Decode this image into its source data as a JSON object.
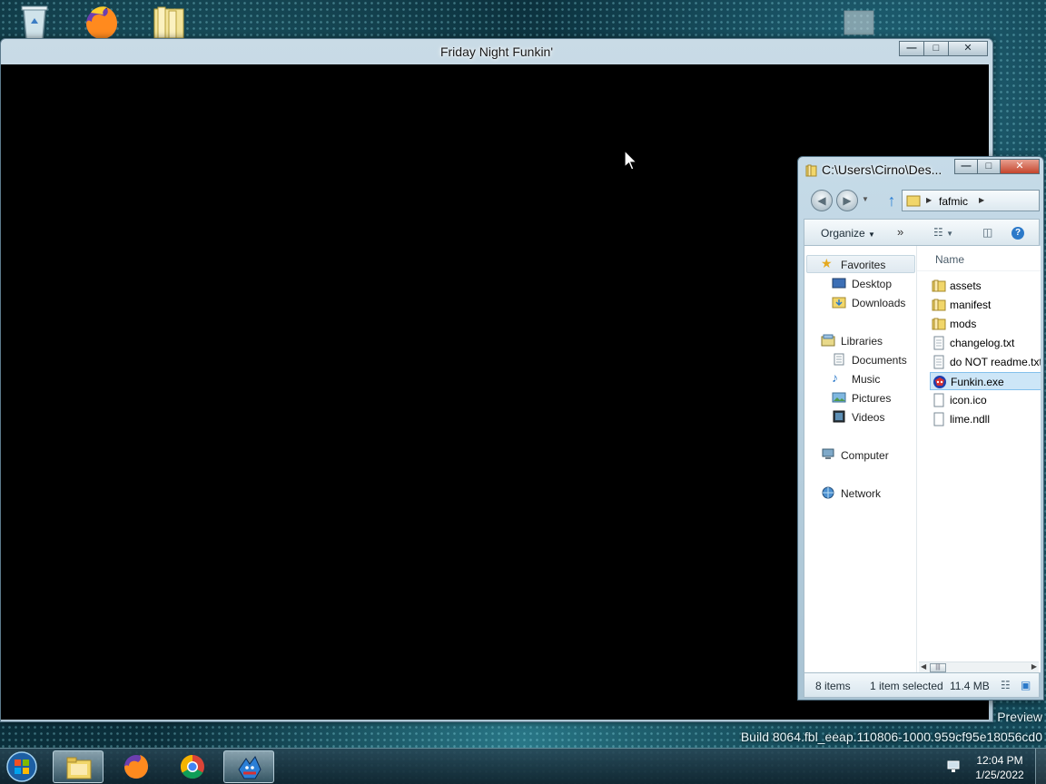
{
  "game_window": {
    "title": "Friday Night Funkin'",
    "buttons": {
      "minimize": "—",
      "maximize": "□",
      "close": "✕"
    }
  },
  "explorer": {
    "title": "C:\\Users\\Cirno\\Des...",
    "buttons": {
      "minimize": "—",
      "maximize": "□",
      "close": "✕"
    },
    "address": {
      "segment": "fafmic"
    },
    "toolbar": {
      "organize": "Organize",
      "more": "»"
    },
    "nav": {
      "favorites": "Favorites",
      "desktop": "Desktop",
      "downloads": "Downloads",
      "libraries": "Libraries",
      "documents": "Documents",
      "music": "Music",
      "pictures": "Pictures",
      "videos": "Videos",
      "computer": "Computer",
      "network": "Network"
    },
    "column_name": "Name",
    "files": [
      {
        "name": "assets",
        "type": "folder"
      },
      {
        "name": "manifest",
        "type": "folder"
      },
      {
        "name": "mods",
        "type": "folder"
      },
      {
        "name": "changelog.txt",
        "type": "text"
      },
      {
        "name": "do NOT readme.txt",
        "type": "text"
      },
      {
        "name": "Funkin.exe",
        "type": "exe",
        "selected": true
      },
      {
        "name": "icon.ico",
        "type": "file"
      },
      {
        "name": "lime.ndll",
        "type": "file"
      }
    ],
    "status": {
      "items": "8 items",
      "selected": "1 item selected",
      "size": "11.4 MB"
    }
  },
  "watermark": {
    "preview": "Preview",
    "build": "Build 8064.fbl_eeap.110806-1000.959cf95e18056cd0"
  },
  "taskbar": {
    "clock_time": "12:04 PM",
    "clock_date": "1/25/2022",
    "apps": [
      "file-explorer-icon",
      "firefox-icon",
      "chrome-icon",
      "funkin-icon"
    ]
  },
  "colors": {
    "selection": "#cde6f7",
    "folder": "#e8c24a",
    "desktop_bg": "#0b2f3b"
  }
}
